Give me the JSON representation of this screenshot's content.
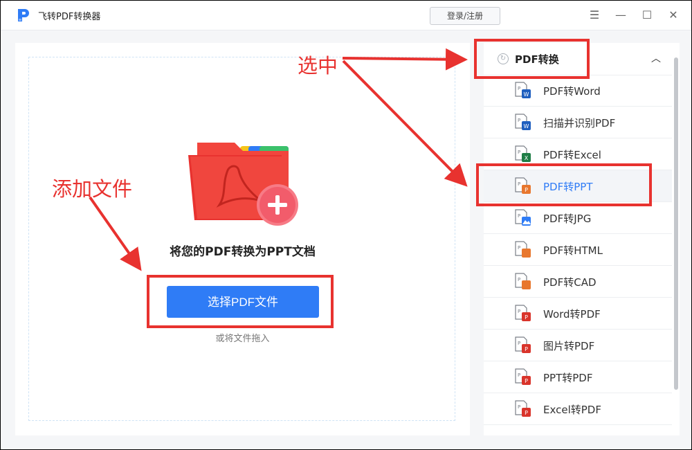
{
  "app": {
    "title": "飞转PDF转换器",
    "login_label": "登录/注册"
  },
  "main": {
    "title": "将您的PDF转换为PPT文档",
    "select_button": "选择PDF文件",
    "drag_hint": "或将文件拖入"
  },
  "sidebar": {
    "header": "PDF转换",
    "items": [
      {
        "label": "PDF转Word",
        "icon": "word-file-icon",
        "color": "#1f5fbf",
        "badge": "W"
      },
      {
        "label": "扫描并识别PDF",
        "icon": "word-file-icon",
        "color": "#1f5fbf",
        "badge": "W"
      },
      {
        "label": "PDF转Excel",
        "icon": "excel-file-icon",
        "color": "#1e7d45",
        "badge": "X"
      },
      {
        "label": "PDF转PPT",
        "icon": "ppt-file-icon",
        "color": "#e8772e",
        "badge": "P"
      },
      {
        "label": "PDF转JPG",
        "icon": "image-file-icon",
        "color": "#2f7cf6",
        "badge": ""
      },
      {
        "label": "PDF转HTML",
        "icon": "html-file-icon",
        "color": "#e8772e",
        "badge": "</>"
      },
      {
        "label": "PDF转CAD",
        "icon": "cad-file-icon",
        "color": "#e8772e",
        "badge": "</>"
      },
      {
        "label": "Word转PDF",
        "icon": "pdf-file-icon",
        "color": "#d9342b",
        "badge": "P"
      },
      {
        "label": "图片转PDF",
        "icon": "pdf-file-icon",
        "color": "#d9342b",
        "badge": "P"
      },
      {
        "label": "PPT转PDF",
        "icon": "pdf-file-icon",
        "color": "#d9342b",
        "badge": "P"
      },
      {
        "label": "Excel转PDF",
        "icon": "pdf-file-icon",
        "color": "#d9342b",
        "badge": "P"
      }
    ]
  },
  "annotations": {
    "select_label": "选中",
    "add_file_label": "添加文件",
    "color": "#e8322f"
  },
  "colors": {
    "accent": "#2f7cf6",
    "folder_red": "#f2453d"
  }
}
